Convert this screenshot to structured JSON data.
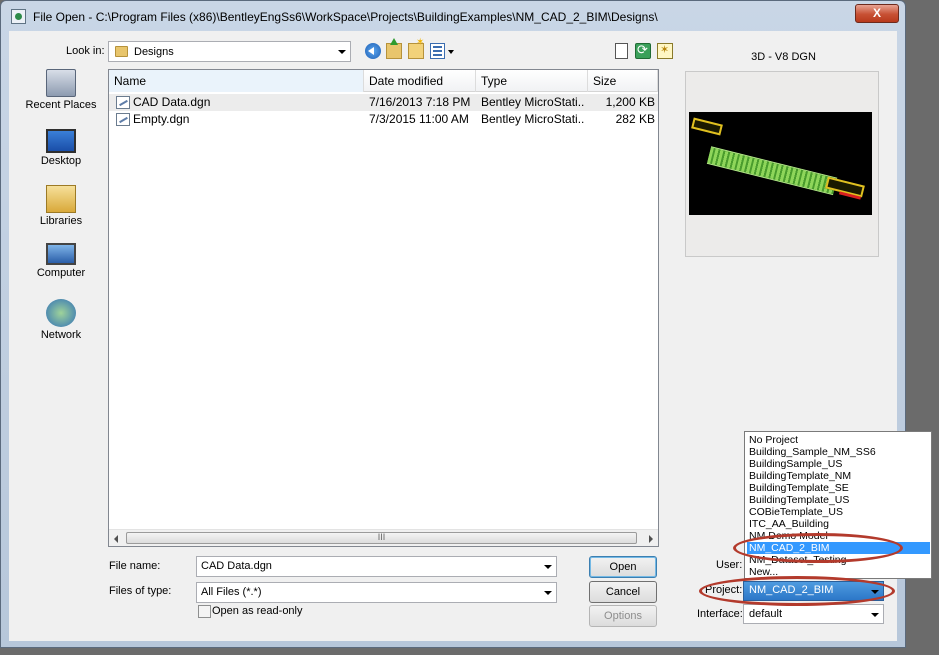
{
  "window": {
    "title": "File Open - C:\\Program Files (x86)\\BentleyEngSs6\\WorkSpace\\Projects\\BuildingExamples\\NM_CAD_2_BIM\\Designs\\",
    "close_glyph": "X"
  },
  "toolbar": {
    "look_in_label": "Look in:",
    "look_in_value": "Designs",
    "icons": [
      "back-icon",
      "up-folder-icon",
      "new-folder-icon",
      "views-menu-icon",
      "new-file-icon",
      "refresh-icon",
      "favorite-icon"
    ]
  },
  "places": [
    {
      "label": "Recent Places",
      "icon": "recent-places-icon"
    },
    {
      "label": "Desktop",
      "icon": "desktop-icon"
    },
    {
      "label": "Libraries",
      "icon": "libraries-icon"
    },
    {
      "label": "Computer",
      "icon": "computer-icon"
    },
    {
      "label": "Network",
      "icon": "network-icon"
    }
  ],
  "file_list": {
    "columns": [
      "Name",
      "Date modified",
      "Type",
      "Size"
    ],
    "rows": [
      {
        "name": "CAD Data.dgn",
        "date": "7/16/2013 7:18 PM",
        "type": "Bentley MicroStati...",
        "size": "1,200 KB"
      },
      {
        "name": "Empty.dgn",
        "date": "7/3/2015 11:00 AM",
        "type": "Bentley MicroStati...",
        "size": "282 KB"
      }
    ],
    "scroll_thumb_glyph": "III"
  },
  "form": {
    "file_name_label": "File name:",
    "file_name_value": "CAD Data.dgn",
    "files_of_type_label": "Files of type:",
    "files_of_type_value": "All Files (*.*)",
    "read_only_label": "Open as read-only",
    "open_button": "Open",
    "cancel_button": "Cancel",
    "options_button": "Options"
  },
  "preview": {
    "title": "3D - V8 DGN"
  },
  "workspace": {
    "user_label": "User:",
    "project_label": "Project:",
    "project_value": "NM_CAD_2_BIM",
    "interface_label": "Interface:",
    "interface_value": "default",
    "project_options": [
      "No Project",
      "Building_Sample_NM_SS6",
      "BuildingSample_US",
      "BuildingTemplate_NM",
      "BuildingTemplate_SE",
      "BuildingTemplate_US",
      "COBieTemplate_US",
      "ITC_AA_Building",
      "NM Demo Model",
      "NM_CAD_2_BIM",
      "NM_Dataset_Testing",
      "New..."
    ],
    "selected_option_index": 9
  },
  "colors": {
    "selection": "#3399ff",
    "annotation_ring": "#b33a2c"
  }
}
